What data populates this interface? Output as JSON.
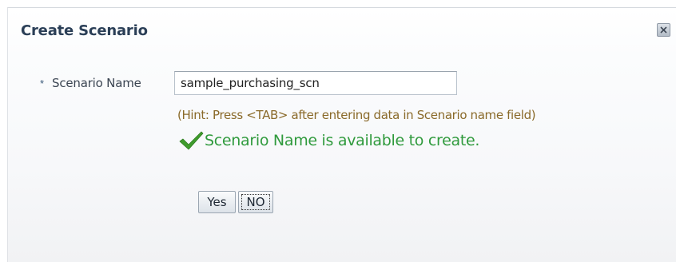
{
  "dialog": {
    "title": "Create Scenario",
    "close_icon": "close-icon"
  },
  "form": {
    "required_marker": "*",
    "field_label": "Scenario Name",
    "field_value": "sample_purchasing_scn",
    "hint": "(Hint: Press <TAB> after entering data in Scenario name field)",
    "success_icon": "checkmark-icon",
    "success_message": "Scenario Name is available to create."
  },
  "buttons": {
    "yes_label": "Yes",
    "no_label": "NO"
  },
  "colors": {
    "title": "#2b3f57",
    "hint": "#8a6a2a",
    "success": "#2f9a3c"
  }
}
